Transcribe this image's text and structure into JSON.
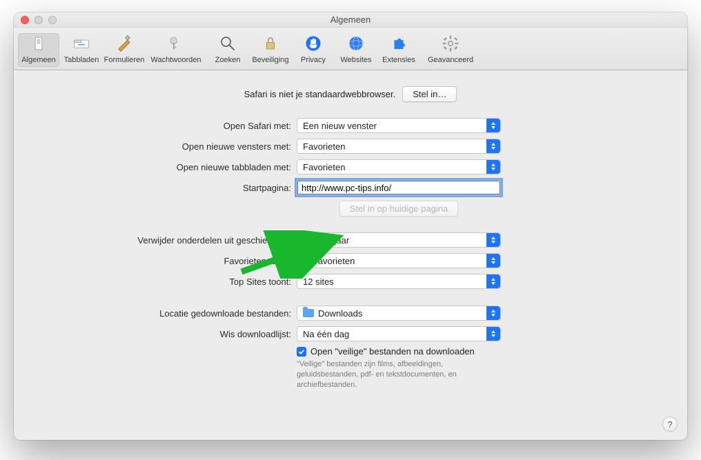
{
  "window": {
    "title": "Algemeen"
  },
  "toolbar": {
    "items": [
      {
        "label": "Algemeen"
      },
      {
        "label": "Tabbladen"
      },
      {
        "label": "Formulieren"
      },
      {
        "label": "Wachtwoorden"
      },
      {
        "label": "Zoeken"
      },
      {
        "label": "Beveiliging"
      },
      {
        "label": "Privacy"
      },
      {
        "label": "Websites"
      },
      {
        "label": "Extensies"
      },
      {
        "label": "Geavanceerd"
      }
    ]
  },
  "defaultBrowser": {
    "text": "Safari is niet je standaardwebbrowser.",
    "button": "Stel in…"
  },
  "form": {
    "openSafari": {
      "label": "Open Safari met:",
      "value": "Een nieuw venster"
    },
    "openWindows": {
      "label": "Open nieuwe vensters met:",
      "value": "Favorieten"
    },
    "openTabs": {
      "label": "Open nieuwe tabbladen met:",
      "value": "Favorieten"
    },
    "homepage": {
      "label": "Startpagina:",
      "value": "http://www.pc-tips.info/"
    },
    "setCurrent": {
      "button": "Stel in op huidige pagina"
    },
    "removeHistory": {
      "label": "Verwijder onderdelen uit geschiedenis:",
      "value": "Na één jaar"
    },
    "favoritesShows": {
      "label": "Favorieten toont:",
      "value": "Favorieten"
    },
    "topSitesShows": {
      "label": "Top Sites toont:",
      "value": "12 sites"
    },
    "downloadLocation": {
      "label": "Locatie gedownloade bestanden:",
      "value": "Downloads"
    },
    "clearDownloads": {
      "label": "Wis downloadlijst:",
      "value": "Na één dag"
    },
    "safeFiles": {
      "label": "Open \"veilige\" bestanden na downloaden",
      "hint": "\"Veilige\" bestanden zijn films, afbeeldingen, geluidsbestanden, pdf- en tekstdocumenten, en archiefbestanden.",
      "checked": true
    }
  },
  "help": {
    "glyph": "?"
  }
}
